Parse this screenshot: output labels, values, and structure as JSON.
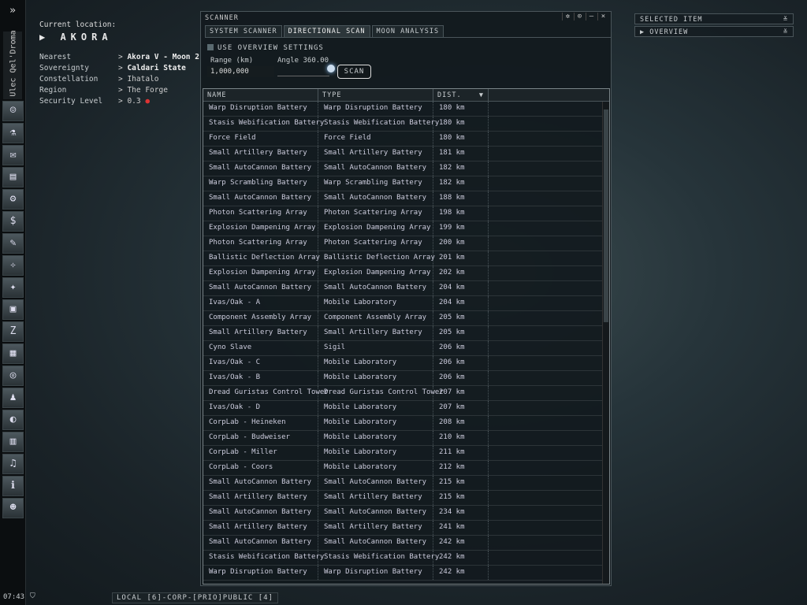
{
  "neocom": {
    "pilot": "Ulec Qel'Droma",
    "expand": "»",
    "icons": [
      "character-portrait",
      "science",
      "mail",
      "notepad",
      "fitting",
      "market",
      "contracts",
      "map",
      "starmap",
      "assets",
      "corporation",
      "calculator",
      "help",
      "skills",
      "browser",
      "journal",
      "audio",
      "info",
      "agent"
    ]
  },
  "location": {
    "title": "Current location:",
    "system": "AKORA",
    "rows": [
      {
        "k": "Nearest",
        "v": "Akora V - Moon 2",
        "bold": true
      },
      {
        "k": "Sovereignty",
        "v": "Caldari State",
        "bold": true
      },
      {
        "k": "Constellation",
        "v": "Ihatalo"
      },
      {
        "k": "Region",
        "v": "The Forge"
      },
      {
        "k": "Security Level",
        "v": "0.3"
      }
    ]
  },
  "scanner": {
    "title": "SCANNER",
    "tabs": [
      "SYSTEM SCANNER",
      "DIRECTIONAL SCAN",
      "MOON ANALYSIS"
    ],
    "use_overview": "USE OVERVIEW SETTINGS",
    "range_label": "Range (km)",
    "range_value": "1,000,000",
    "angle_label": "Angle 360.00",
    "scan_button": "SCAN",
    "columns": [
      "NAME",
      "TYPE",
      "DIST."
    ],
    "rows": [
      [
        "Warp Disruption Battery",
        "Warp Disruption Battery",
        "180 km"
      ],
      [
        "Stasis Webification Battery",
        "Stasis Webification Battery",
        "180 km"
      ],
      [
        "Force Field",
        "Force Field",
        "180 km"
      ],
      [
        "Small Artillery Battery",
        "Small Artillery Battery",
        "181 km"
      ],
      [
        "Small AutoCannon Battery",
        "Small AutoCannon Battery",
        "182 km"
      ],
      [
        "Warp Scrambling Battery",
        "Warp Scrambling Battery",
        "182 km"
      ],
      [
        "Small AutoCannon Battery",
        "Small AutoCannon Battery",
        "188 km"
      ],
      [
        "Photon Scattering Array",
        "Photon Scattering Array",
        "198 km"
      ],
      [
        "Explosion Dampening Array",
        "Explosion Dampening Array",
        "199 km"
      ],
      [
        "Photon Scattering Array",
        "Photon Scattering Array",
        "200 km"
      ],
      [
        "Ballistic Deflection Array",
        "Ballistic Deflection Array",
        "201 km"
      ],
      [
        "Explosion Dampening Array",
        "Explosion Dampening Array",
        "202 km"
      ],
      [
        "Small AutoCannon Battery",
        "Small AutoCannon Battery",
        "204 km"
      ],
      [
        "Ivas/Oak - A",
        "Mobile Laboratory",
        "204 km"
      ],
      [
        "Component Assembly Array",
        "Component Assembly Array",
        "205 km"
      ],
      [
        "Small Artillery Battery",
        "Small Artillery Battery",
        "205 km"
      ],
      [
        "Cyno Slave",
        "Sigil",
        "206 km"
      ],
      [
        "Ivas/Oak - C",
        "Mobile Laboratory",
        "206 km"
      ],
      [
        "Ivas/Oak - B",
        "Mobile Laboratory",
        "206 km"
      ],
      [
        "Dread Guristas Control Tower",
        "Dread Guristas Control Tower",
        "207 km"
      ],
      [
        "Ivas/Oak - D",
        "Mobile Laboratory",
        "207 km"
      ],
      [
        "CorpLab - Heineken",
        "Mobile Laboratory",
        "208 km"
      ],
      [
        "CorpLab - Budweiser",
        "Mobile Laboratory",
        "210 km"
      ],
      [
        "CorpLab - Miller",
        "Mobile Laboratory",
        "211 km"
      ],
      [
        "CorpLab - Coors",
        "Mobile Laboratory",
        "212 km"
      ],
      [
        "Small AutoCannon Battery",
        "Small AutoCannon Battery",
        "215 km"
      ],
      [
        "Small Artillery Battery",
        "Small Artillery Battery",
        "215 km"
      ],
      [
        "Small AutoCannon Battery",
        "Small AutoCannon Battery",
        "234 km"
      ],
      [
        "Small Artillery Battery",
        "Small Artillery Battery",
        "241 km"
      ],
      [
        "Small AutoCannon Battery",
        "Small AutoCannon Battery",
        "242 km"
      ],
      [
        "Stasis Webification Battery",
        "Stasis Webification Battery",
        "242 km"
      ],
      [
        "Warp Disruption Battery",
        "Warp Disruption Battery",
        "242 km"
      ]
    ]
  },
  "right_panel": {
    "selected_item": "SELECTED ITEM",
    "overview": "OVERVIEW"
  },
  "bottom": {
    "clock": "07:43",
    "chat": "LOCAL [6]-CORP-[PRIO]PUBLIC [4]"
  }
}
